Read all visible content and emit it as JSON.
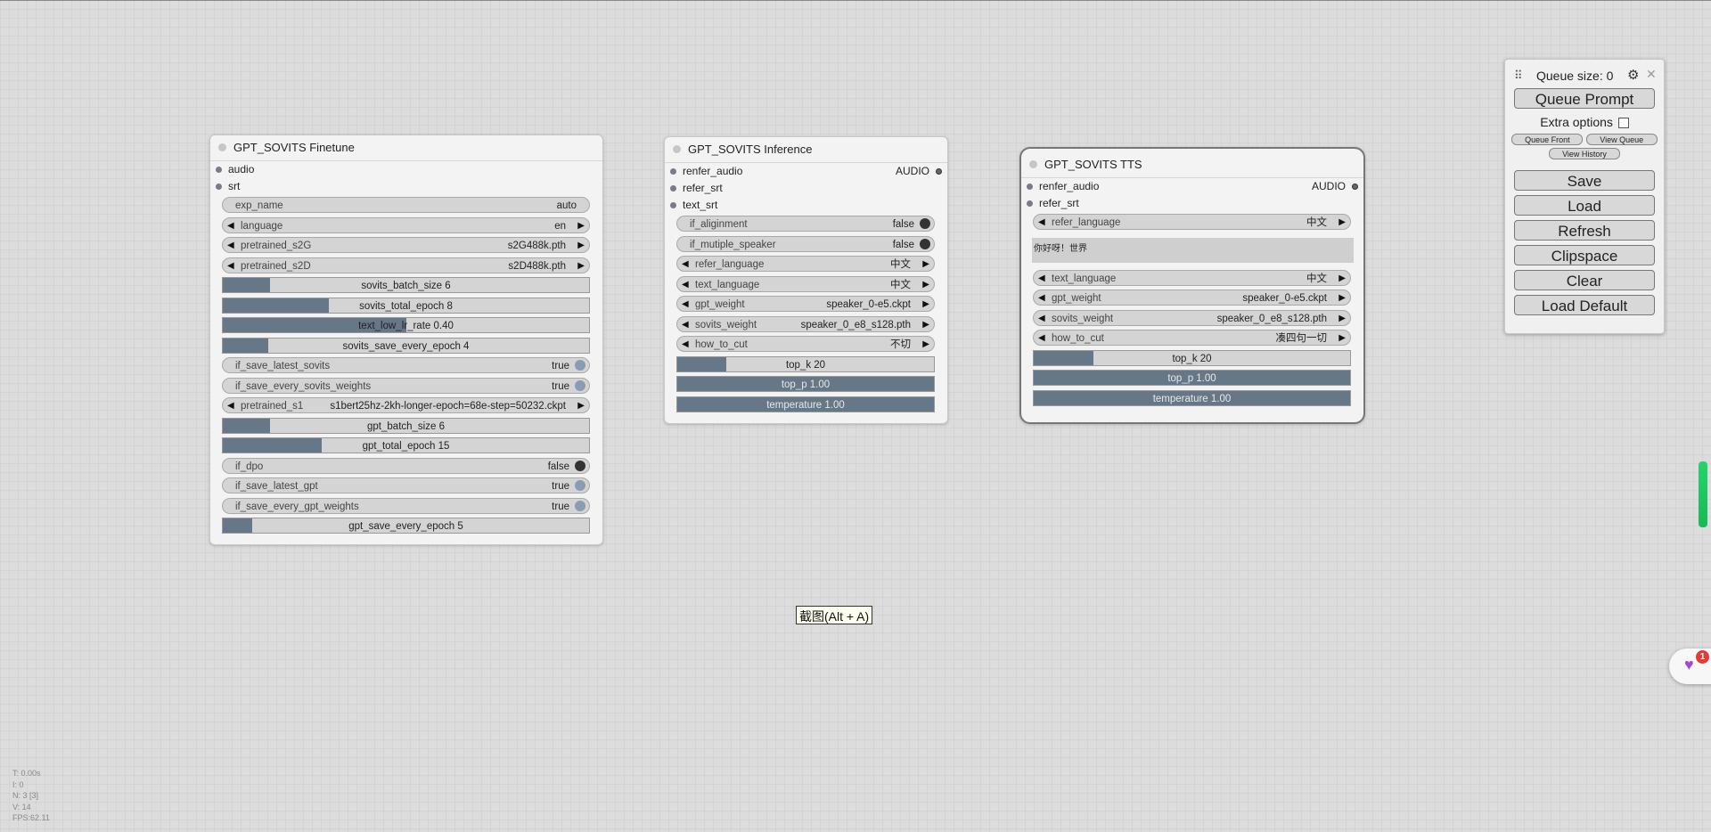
{
  "finetune": {
    "title": "GPT_SOVITS Finetune",
    "inputs": [
      "audio",
      "srt"
    ],
    "exp_name": {
      "label": "exp_name",
      "value": "auto"
    },
    "language": {
      "label": "language",
      "value": "en"
    },
    "pretrained_s2G": {
      "label": "pretrained_s2G",
      "value": "s2G488k.pth"
    },
    "pretrained_s2D": {
      "label": "pretrained_s2D",
      "value": "s2D488k.pth"
    },
    "sovits_batch_size": {
      "text": "sovits_batch_size  6",
      "fill": 0.13
    },
    "sovits_total_epoch": {
      "text": "sovits_total_epoch  8",
      "fill": 0.29
    },
    "text_low_lr_rate": {
      "text": "text_low_lr_rate  0.40",
      "fill": 0.5
    },
    "sovits_save_every_epoch": {
      "text": "sovits_save_every_epoch  4",
      "fill": 0.125
    },
    "if_save_latest_sovits": {
      "label": "if_save_latest_sovits",
      "value": "true"
    },
    "if_save_every_sovits_weights": {
      "label": "if_save_every_sovits_weights",
      "value": "true"
    },
    "pretrained_s1": {
      "label": "pretrained_s1",
      "value": "s1bert25hz-2kh-longer-epoch=68e-step=50232.ckpt"
    },
    "gpt_batch_size": {
      "text": "gpt_batch_size  6",
      "fill": 0.13
    },
    "gpt_total_epoch": {
      "text": "gpt_total_epoch  15",
      "fill": 0.27
    },
    "if_dpo": {
      "label": "if_dpo",
      "value": "false"
    },
    "if_save_latest_gpt": {
      "label": "if_save_latest_gpt",
      "value": "true"
    },
    "if_save_every_gpt_weights": {
      "label": "if_save_every_gpt_weights",
      "value": "true"
    },
    "gpt_save_every_epoch": {
      "text": "gpt_save_every_epoch  5",
      "fill": 0.08
    }
  },
  "inference": {
    "title": "GPT_SOVITS Inference",
    "inputs": [
      "renfer_audio",
      "refer_srt",
      "text_srt"
    ],
    "output": "AUDIO",
    "if_aliginment": {
      "label": "if_aliginment",
      "value": "false"
    },
    "if_mutiple_speaker": {
      "label": "if_mutiple_speaker",
      "value": "false"
    },
    "refer_language": {
      "label": "refer_language",
      "value": "中文"
    },
    "text_language": {
      "label": "text_language",
      "value": "中文"
    },
    "gpt_weight": {
      "label": "gpt_weight",
      "value": "speaker_0-e5.ckpt"
    },
    "sovits_weight": {
      "label": "sovits_weight",
      "value": "speaker_0_e8_s128.pth"
    },
    "how_to_cut": {
      "label": "how_to_cut",
      "value": "不切"
    },
    "top_k": {
      "text": "top_k  20",
      "fill": 0.19
    },
    "top_p": {
      "text": "top_p  1.00",
      "fill": 1.0
    },
    "temperature": {
      "text": "temperature  1.00",
      "fill": 1.0
    }
  },
  "tts": {
    "title": "GPT_SOVITS TTS",
    "inputs": [
      "renfer_audio",
      "refer_srt"
    ],
    "output": "AUDIO",
    "refer_language": {
      "label": "refer_language",
      "value": "中文"
    },
    "text": "你好呀！世界",
    "text_language": {
      "label": "text_language",
      "value": "中文"
    },
    "gpt_weight": {
      "label": "gpt_weight",
      "value": "speaker_0-e5.ckpt"
    },
    "sovits_weight": {
      "label": "sovits_weight",
      "value": "speaker_0_e8_s128.pth"
    },
    "how_to_cut": {
      "label": "how_to_cut",
      "value": "凑四句一切"
    },
    "top_k": {
      "text": "top_k  20",
      "fill": 0.19
    },
    "top_p": {
      "text": "top_p  1.00",
      "fill": 1.0
    },
    "temperature": {
      "text": "temperature  1.00",
      "fill": 1.0
    }
  },
  "menu": {
    "queue_size": "Queue size: 0",
    "queue_prompt": "Queue Prompt",
    "extra_options": "Extra options",
    "queue_front": "Queue Front",
    "view_queue": "View Queue",
    "view_history": "View History",
    "save": "Save",
    "load": "Load",
    "refresh": "Refresh",
    "clipspace": "Clipspace",
    "clear": "Clear",
    "load_default": "Load Default"
  },
  "stats": [
    "T: 0.00s",
    "I: 0",
    "N: 3 [3]",
    "V: 14",
    "FPS:62.11"
  ],
  "tooltip": "截图(Alt + A)",
  "badge_count": "1"
}
